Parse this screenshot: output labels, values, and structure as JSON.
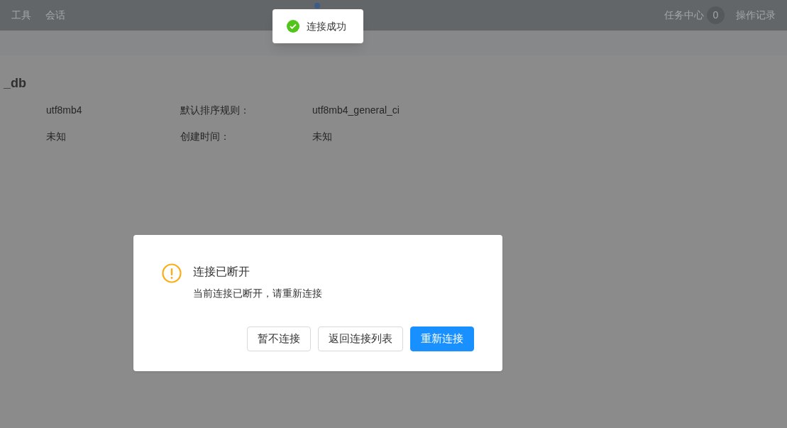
{
  "top_bar": {
    "menu": [
      "工具",
      "会话"
    ],
    "task_center": {
      "label": "任务中心",
      "count": "0"
    },
    "operation_log": "操作记录"
  },
  "database": {
    "title": "_db",
    "rows": [
      {
        "value": "utf8mb4",
        "label": "默认排序规则：",
        "value_2": "utf8mb4_general_ci"
      },
      {
        "value": "未知",
        "label": "创建时间：",
        "value_2": "未知"
      }
    ]
  },
  "toast": {
    "kind": "success",
    "message": "连接成功"
  },
  "dialog": {
    "kind": "warning",
    "title": "连接已断开",
    "message": "当前连接已断开，请重新连接",
    "buttons": [
      {
        "label": "暂不连接",
        "primary": false
      },
      {
        "label": "返回连接列表",
        "primary": false
      },
      {
        "label": "重新连接",
        "primary": true
      }
    ]
  }
}
